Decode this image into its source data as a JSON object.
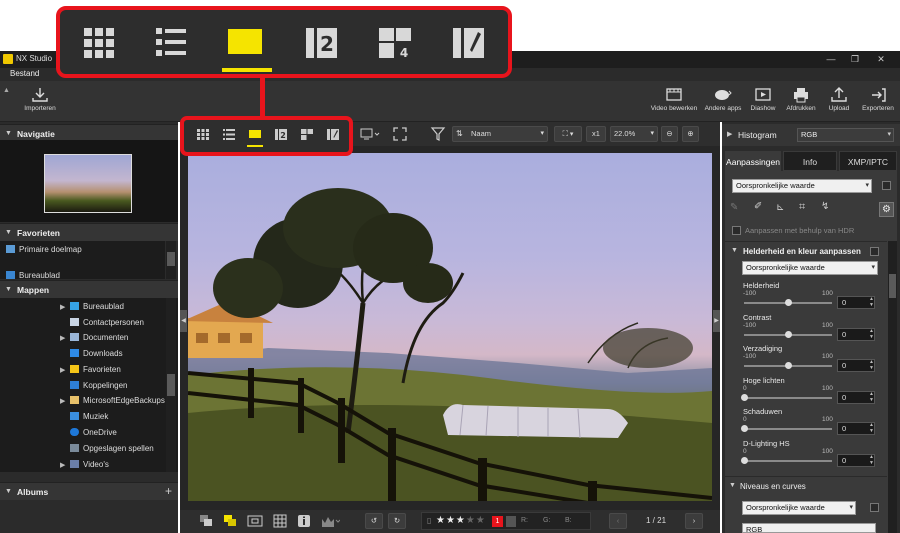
{
  "window": {
    "title": "NX Studio"
  },
  "menu": {
    "file": "Bestand"
  },
  "toolbar": {
    "import": "Importeren",
    "edit_movie": "Video bewerken",
    "other_apps": "Andere apps",
    "slideshow": "Diashow",
    "print": "Afdrukken",
    "upload": "Upload",
    "export": "Exporteren"
  },
  "left": {
    "navigation": "Navigatie",
    "favorites": "Favorieten",
    "favorites_items": [
      "Primaire doelmap",
      "Bureaublad"
    ],
    "folders": "Mappen",
    "folder_items": [
      "Bureaublad",
      "Contactpersonen",
      "Documenten",
      "Downloads",
      "Favorieten",
      "Koppelingen",
      "MicrosoftEdgeBackups",
      "Muziek",
      "OneDrive",
      "Opgeslagen spellen",
      "Video's"
    ],
    "albums": "Albums"
  },
  "center": {
    "sort_label": "Naam",
    "zoom_multiplier": "x1",
    "zoom_percent": "22.0%",
    "rating_filter": "1",
    "rgb_r": "R:",
    "rgb_g": "G:",
    "rgb_b": "B:",
    "page": "1 / 21"
  },
  "right": {
    "histogram": "Histogram",
    "histogram_channel": "RGB",
    "tabs": [
      "Aanpassingen",
      "Info",
      "XMP/IPTC"
    ],
    "preset": "Oorspronkelijke waarde",
    "hdr": "Aanpassen met behulp van HDR",
    "section1": "Helderheid en kleur aanpassen",
    "section1_preset": "Oorspronkelijke waarde",
    "sliders": [
      {
        "label": "Helderheid",
        "min": "-100",
        "max": "100",
        "value": "0",
        "level": 0.5
      },
      {
        "label": "Contrast",
        "min": "-100",
        "max": "100",
        "value": "0",
        "level": 0.5
      },
      {
        "label": "Verzadiging",
        "min": "-100",
        "max": "100",
        "value": "0",
        "level": 0.5
      },
      {
        "label": "Hoge lichten",
        "min": "0",
        "max": "100",
        "value": "0",
        "level": 0.0
      },
      {
        "label": "Schaduwen",
        "min": "0",
        "max": "100",
        "value": "0",
        "level": 0.0
      },
      {
        "label": "D-Lighting HS",
        "min": "0",
        "max": "100",
        "value": "0",
        "level": 0.0
      }
    ],
    "section2": "Niveaus en curves",
    "section2_preset": "Oorspronkelijke waarde",
    "section2_channel": "RGB"
  },
  "colors": {
    "callout": "#e8141c",
    "active_view": "#f5e400"
  }
}
